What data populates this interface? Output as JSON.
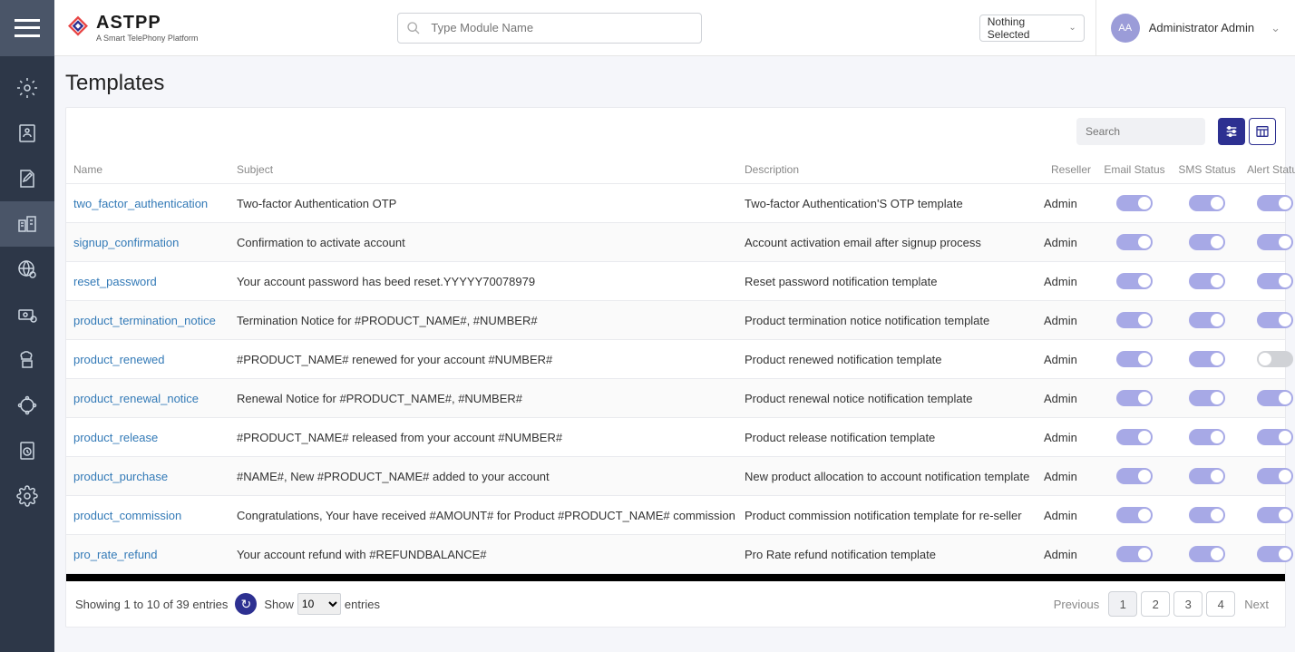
{
  "header": {
    "logo_main": "ASTPP",
    "logo_sub": "A Smart TelePhony Platform",
    "search_placeholder": "Type Module Name",
    "dropdown_selected": "Nothing Selected",
    "avatar_initials": "AA",
    "user_name": "Administrator Admin"
  },
  "page_title": "Templates",
  "table": {
    "search_placeholder": "Search",
    "columns": [
      "Name",
      "Subject",
      "Description",
      "Reseller",
      "Email Status",
      "SMS Status",
      "Alert Status"
    ],
    "rows": [
      {
        "name": "two_factor_authentication",
        "subject": "Two-factor Authentication OTP",
        "description": "Two-factor Authentication'S OTP template",
        "reseller": "Admin",
        "email": true,
        "sms": true,
        "alert": true
      },
      {
        "name": "signup_confirmation",
        "subject": "Confirmation to activate account",
        "description": "Account activation email after signup process",
        "reseller": "Admin",
        "email": true,
        "sms": true,
        "alert": true
      },
      {
        "name": "reset_password",
        "subject": "Your account password has beed reset.YYYYY70078979",
        "description": "Reset password notification template",
        "reseller": "Admin",
        "email": true,
        "sms": true,
        "alert": true
      },
      {
        "name": "product_termination_notice",
        "subject": "Termination Notice for #PRODUCT_NAME#, #NUMBER#",
        "description": "Product termination notice notification template",
        "reseller": "Admin",
        "email": true,
        "sms": true,
        "alert": true
      },
      {
        "name": "product_renewed",
        "subject": "#PRODUCT_NAME# renewed for your account #NUMBER#",
        "description": "Product renewed notification template",
        "reseller": "Admin",
        "email": true,
        "sms": true,
        "alert": false
      },
      {
        "name": "product_renewal_notice",
        "subject": "Renewal Notice for #PRODUCT_NAME#, #NUMBER#",
        "description": "Product renewal notice notification template",
        "reseller": "Admin",
        "email": true,
        "sms": true,
        "alert": true
      },
      {
        "name": "product_release",
        "subject": "#PRODUCT_NAME# released from your account #NUMBER#",
        "description": "Product release notification template",
        "reseller": "Admin",
        "email": true,
        "sms": true,
        "alert": true
      },
      {
        "name": "product_purchase",
        "subject": "#NAME#, New #PRODUCT_NAME# added to your account",
        "description": "New product allocation to account notification template",
        "reseller": "Admin",
        "email": true,
        "sms": true,
        "alert": true
      },
      {
        "name": "product_commission",
        "subject": "Congratulations, Your have received #AMOUNT# for Product #PRODUCT_NAME# commission",
        "description": "Product commission notification template for re-seller",
        "reseller": "Admin",
        "email": true,
        "sms": true,
        "alert": true
      },
      {
        "name": "pro_rate_refund",
        "subject": "Your account refund with #REFUNDBALANCE#",
        "description": "Pro Rate refund notification template",
        "reseller": "Admin",
        "email": true,
        "sms": true,
        "alert": true
      }
    ]
  },
  "footer": {
    "showing": "Showing 1 to 10 of 39 entries",
    "show_label": "Show",
    "entries_label": "entries",
    "page_size": "10",
    "prev": "Previous",
    "next": "Next",
    "pages": [
      "1",
      "2",
      "3",
      "4"
    ],
    "active_page": "1"
  }
}
